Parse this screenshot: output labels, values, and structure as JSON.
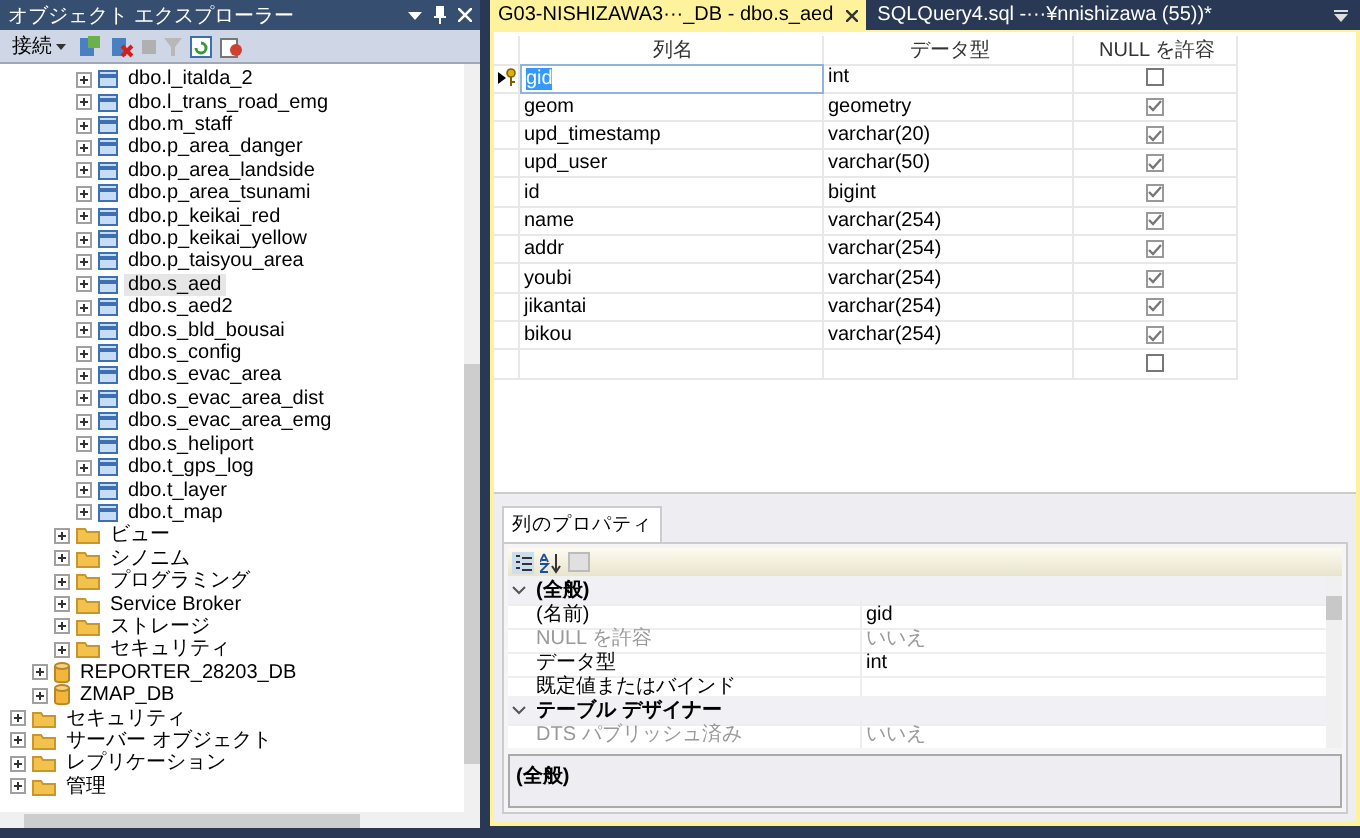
{
  "object_explorer": {
    "title": "オブジェクト エクスプローラー",
    "toolbar": {
      "connect_label": "接続"
    },
    "tree": [
      {
        "children": [
          {
            "children": [
              {
                "children": [
                  {
                    "label": "dbo.l_italda_2",
                    "kind": "table",
                    "expanded": false,
                    "selected": false
                  },
                  {
                    "label": "dbo.l_trans_road_emg",
                    "kind": "table",
                    "expanded": false,
                    "selected": false
                  },
                  {
                    "label": "dbo.m_staff",
                    "kind": "table",
                    "expanded": false,
                    "selected": false
                  },
                  {
                    "label": "dbo.p_area_danger",
                    "kind": "table",
                    "expanded": false,
                    "selected": false
                  },
                  {
                    "label": "dbo.p_area_landside",
                    "kind": "table",
                    "expanded": false,
                    "selected": false
                  },
                  {
                    "label": "dbo.p_area_tsunami",
                    "kind": "table",
                    "expanded": false,
                    "selected": false
                  },
                  {
                    "label": "dbo.p_keikai_red",
                    "kind": "table",
                    "expanded": false,
                    "selected": false
                  },
                  {
                    "label": "dbo.p_keikai_yellow",
                    "kind": "table",
                    "expanded": false,
                    "selected": false
                  },
                  {
                    "label": "dbo.p_taisyou_area",
                    "kind": "table",
                    "expanded": false,
                    "selected": false
                  },
                  {
                    "label": "dbo.s_aed",
                    "kind": "table",
                    "expanded": false,
                    "selected": true
                  },
                  {
                    "label": "dbo.s_aed2",
                    "kind": "table",
                    "expanded": false,
                    "selected": false
                  },
                  {
                    "label": "dbo.s_bld_bousai",
                    "kind": "table",
                    "expanded": false,
                    "selected": false
                  },
                  {
                    "label": "dbo.s_config",
                    "kind": "table",
                    "expanded": false,
                    "selected": false
                  },
                  {
                    "label": "dbo.s_evac_area",
                    "kind": "table",
                    "expanded": false,
                    "selected": false
                  },
                  {
                    "label": "dbo.s_evac_area_dist",
                    "kind": "table",
                    "expanded": false,
                    "selected": false
                  },
                  {
                    "label": "dbo.s_evac_area_emg",
                    "kind": "table",
                    "expanded": false,
                    "selected": false
                  },
                  {
                    "label": "dbo.s_heliport",
                    "kind": "table",
                    "expanded": false,
                    "selected": false
                  },
                  {
                    "label": "dbo.t_gps_log",
                    "kind": "table",
                    "expanded": false,
                    "selected": false
                  },
                  {
                    "label": "dbo.t_layer",
                    "kind": "table",
                    "expanded": false,
                    "selected": false
                  },
                  {
                    "label": "dbo.t_map",
                    "kind": "table",
                    "expanded": false,
                    "selected": false
                  }
                ]
              },
              {
                "label": "ビュー",
                "kind": "folder",
                "expanded": false,
                "selected": false
              },
              {
                "label": "シノニム",
                "kind": "folder",
                "expanded": false,
                "selected": false
              },
              {
                "label": "プログラミング",
                "kind": "folder",
                "expanded": false,
                "selected": false
              },
              {
                "label": "Service Broker",
                "kind": "folder",
                "expanded": false,
                "selected": false
              },
              {
                "label": "ストレージ",
                "kind": "folder",
                "expanded": false,
                "selected": false
              },
              {
                "label": "セキュリティ",
                "kind": "folder",
                "expanded": false,
                "selected": false
              }
            ]
          },
          {
            "label": "REPORTER_28203_DB",
            "kind": "database",
            "expanded": false,
            "selected": false
          },
          {
            "label": "ZMAP_DB",
            "kind": "database",
            "expanded": false,
            "selected": false
          }
        ]
      },
      {
        "label": "セキュリティ",
        "kind": "folder",
        "expanded": false,
        "selected": false
      },
      {
        "label": "サーバー オブジェクト",
        "kind": "folder",
        "expanded": false,
        "selected": false
      },
      {
        "label": "レプリケーション",
        "kind": "folder",
        "expanded": false,
        "selected": false
      },
      {
        "label": "管理",
        "kind": "folder",
        "expanded": false,
        "selected": false
      }
    ]
  },
  "tabs": [
    {
      "label": "G03-NISHIZAWA3···_DB - dbo.s_aed",
      "selected": true
    },
    {
      "label": "SQLQuery4.sql -···¥nnishizawa (55))*",
      "selected": false
    }
  ],
  "table_designer": {
    "columns": [
      "列名",
      "データ型",
      "NULL を許容"
    ],
    "rows": [
      {
        "name": "gid",
        "type": "int",
        "allow_null": false,
        "primary_key": true,
        "selected": true
      },
      {
        "name": "geom",
        "type": "geometry",
        "allow_null": true,
        "primary_key": false,
        "selected": false
      },
      {
        "name": "upd_timestamp",
        "type": "varchar(20)",
        "allow_null": true,
        "primary_key": false,
        "selected": false
      },
      {
        "name": "upd_user",
        "type": "varchar(50)",
        "allow_null": true,
        "primary_key": false,
        "selected": false
      },
      {
        "name": "id",
        "type": "bigint",
        "allow_null": true,
        "primary_key": false,
        "selected": false
      },
      {
        "name": "name",
        "type": "varchar(254)",
        "allow_null": true,
        "primary_key": false,
        "selected": false
      },
      {
        "name": "addr",
        "type": "varchar(254)",
        "allow_null": true,
        "primary_key": false,
        "selected": false
      },
      {
        "name": "youbi",
        "type": "varchar(254)",
        "allow_null": true,
        "primary_key": false,
        "selected": false
      },
      {
        "name": "jikantai",
        "type": "varchar(254)",
        "allow_null": true,
        "primary_key": false,
        "selected": false
      },
      {
        "name": "bikou",
        "type": "varchar(254)",
        "allow_null": true,
        "primary_key": false,
        "selected": false
      },
      {
        "allow_null": false,
        "primary_key": false,
        "selected": false
      }
    ]
  },
  "column_properties": {
    "tab": "列のプロパティ",
    "rows": [
      {
        "kind": "category",
        "label": "(全般)",
        "expanded": true
      },
      {
        "kind": "property",
        "label": "(名前)",
        "value": "gid",
        "disabled": false
      },
      {
        "kind": "property",
        "label": "NULL を許容",
        "value": "いいえ",
        "disabled": true
      },
      {
        "kind": "property",
        "label": "データ型",
        "value": "int",
        "disabled": false
      },
      {
        "kind": "property",
        "label": "既定値またはバインド",
        "disabled": false
      },
      {
        "kind": "category",
        "label": "テーブル デザイナー",
        "expanded": true
      },
      {
        "kind": "property",
        "label": "DTS パブリッシュ済み",
        "value": "いいえ",
        "disabled": true
      }
    ],
    "description": "(全般)"
  }
}
